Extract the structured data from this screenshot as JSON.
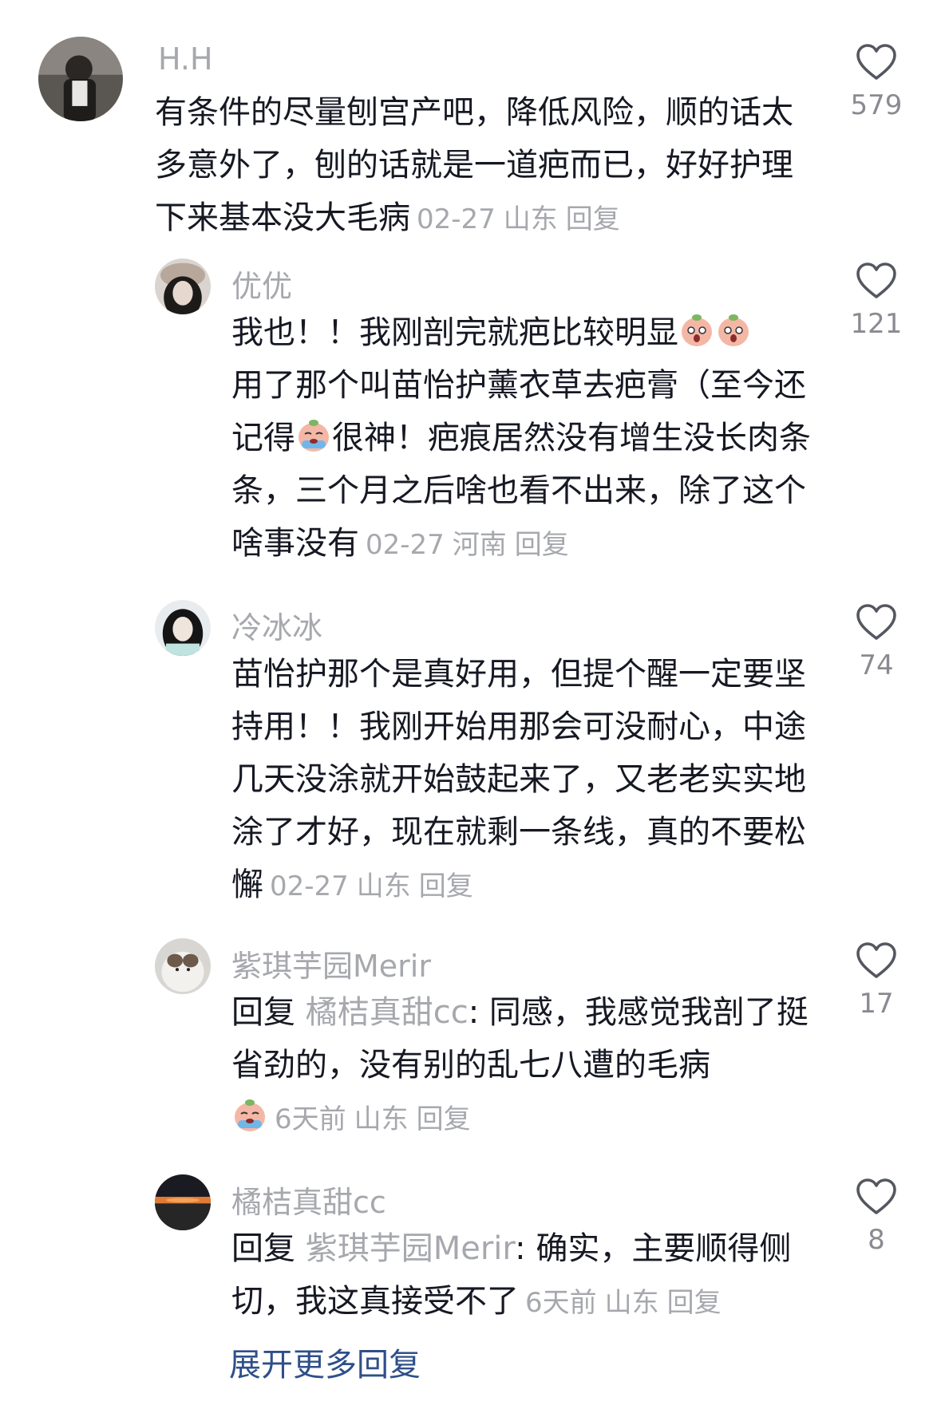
{
  "comments": [
    {
      "username": "H.H",
      "text": "有条件的尽量刨宫产吧，降低风险，顺的话太多意外了，刨的话就是一道疤而已，好好护理下来基本没大毛病",
      "date": "02-27",
      "location": "山东",
      "reply": "回复",
      "likes": "579",
      "avatar_icon": "user-avatar-photo"
    },
    {
      "username": "优优",
      "text_part1": "我也！！我刚剖完就疤比较明显",
      "text_part2": "用了那个叫苗怡护薰衣草去疤膏（至今还记得",
      "text_part3": "很神！疤痕居然没有增生没长肉条条，三个月之后啥也看不出来，除了这个啥事没有",
      "date": "02-27",
      "location": "河南",
      "reply": "回复",
      "likes": "121",
      "emoji_icons": [
        "peach-shocked-emoji",
        "peach-crying-emoji"
      ]
    },
    {
      "username": "冷冰冰",
      "text": "苗怡护那个是真好用，但提个醒一定要坚持用！！我刚开始用那会可没耐心，中途几天没涂就开始鼓起来了，又老老实实地涂了才好，现在就剩一条线，真的不要松懈",
      "date": "02-27",
      "location": "山东",
      "reply": "回复",
      "likes": "74"
    },
    {
      "username": "紫琪芋园Merir",
      "reply_prefix": "回复",
      "mention": "橘桔真甜cc",
      "text": ": 同感，我感觉我剖了挺省劲的，没有别的乱七八遭的毛病",
      "date": "6天前",
      "location": "山东",
      "reply": "回复",
      "likes": "17",
      "emoji_icon": "peach-crying-emoji"
    },
    {
      "username": "橘桔真甜cc",
      "reply_prefix": "回复",
      "mention": "紫琪芋园Merir",
      "text": ": 确实，主要顺得侧切，我这真接受不了",
      "date": "6天前",
      "location": "山东",
      "reply": "回复",
      "likes": "8"
    }
  ],
  "expand_label": "展开更多回复",
  "colors": {
    "text": "#161823",
    "meta": "#a6a8ad",
    "link": "#2f4f89"
  }
}
